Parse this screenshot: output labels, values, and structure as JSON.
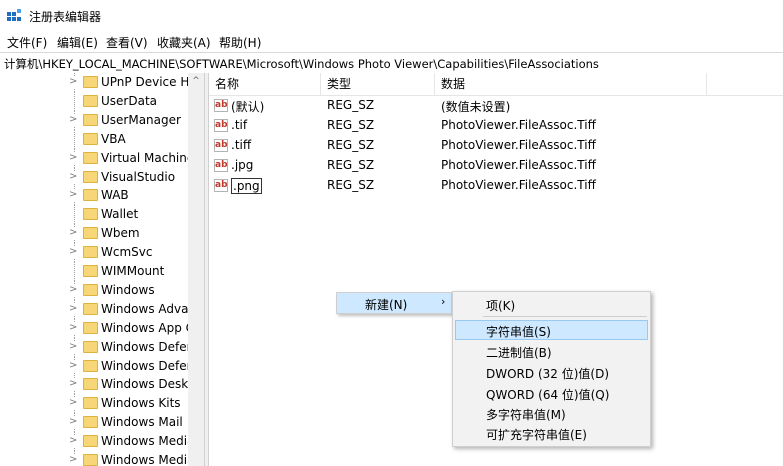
{
  "window": {
    "title": "注册表编辑器"
  },
  "menubar": [
    {
      "label": "文件(F)"
    },
    {
      "label": "编辑(E)"
    },
    {
      "label": "查看(V)"
    },
    {
      "label": "收藏夹(A)"
    },
    {
      "label": "帮助(H)"
    }
  ],
  "address": {
    "path": "计算机\\HKEY_LOCAL_MACHINE\\SOFTWARE\\Microsoft\\Windows Photo Viewer\\Capabilities\\FileAssociations"
  },
  "tree": {
    "scroll_up_glyph": "^",
    "items": [
      {
        "label": "UPnP Device Hc",
        "expander": ">"
      },
      {
        "label": "UserData",
        "expander": ""
      },
      {
        "label": "UserManager",
        "expander": ">"
      },
      {
        "label": "VBA",
        "expander": ""
      },
      {
        "label": "Virtual Machine",
        "expander": ">"
      },
      {
        "label": "VisualStudio",
        "expander": ">"
      },
      {
        "label": "WAB",
        "expander": ">"
      },
      {
        "label": "Wallet",
        "expander": ""
      },
      {
        "label": "Wbem",
        "expander": ">"
      },
      {
        "label": "WcmSvc",
        "expander": ">"
      },
      {
        "label": "WIMMount",
        "expander": ""
      },
      {
        "label": "Windows",
        "expander": ">"
      },
      {
        "label": "Windows Advar",
        "expander": ">"
      },
      {
        "label": "Windows App C",
        "expander": ">"
      },
      {
        "label": "Windows Defen",
        "expander": ">"
      },
      {
        "label": "Windows Defen",
        "expander": ">"
      },
      {
        "label": "Windows Deskt",
        "expander": ">"
      },
      {
        "label": "Windows Kits",
        "expander": ">"
      },
      {
        "label": "Windows Mail",
        "expander": ">"
      },
      {
        "label": "Windows Media",
        "expander": ">"
      },
      {
        "label": "Windows Media",
        "expander": ">"
      }
    ]
  },
  "values": {
    "columns": {
      "name": "名称",
      "type": "类型",
      "data": "数据"
    },
    "icon_text": "ab",
    "rows": [
      {
        "name": "(默认)",
        "type": "REG_SZ",
        "data": "(数值未设置)"
      },
      {
        "name": ".tif",
        "type": "REG_SZ",
        "data": "PhotoViewer.FileAssoc.Tiff"
      },
      {
        "name": ".tiff",
        "type": "REG_SZ",
        "data": "PhotoViewer.FileAssoc.Tiff"
      },
      {
        "name": ".jpg",
        "type": "REG_SZ",
        "data": "PhotoViewer.FileAssoc.Tiff"
      },
      {
        "name": ".png",
        "type": "REG_SZ",
        "data": "PhotoViewer.FileAssoc.Tiff"
      }
    ]
  },
  "context_menu": {
    "new_label": "新建(N)",
    "arrow": "›"
  },
  "submenu": [
    {
      "label": "项(K)"
    },
    {
      "label": "字符串值(S)"
    },
    {
      "label": "二进制值(B)"
    },
    {
      "label": "DWORD (32 位)值(D)"
    },
    {
      "label": "QWORD (64 位)值(Q)"
    },
    {
      "label": "多字符串值(M)"
    },
    {
      "label": "可扩充字符串值(E)"
    }
  ],
  "colors": {
    "highlight": "#cde8ff",
    "folder": "#f6d676"
  }
}
